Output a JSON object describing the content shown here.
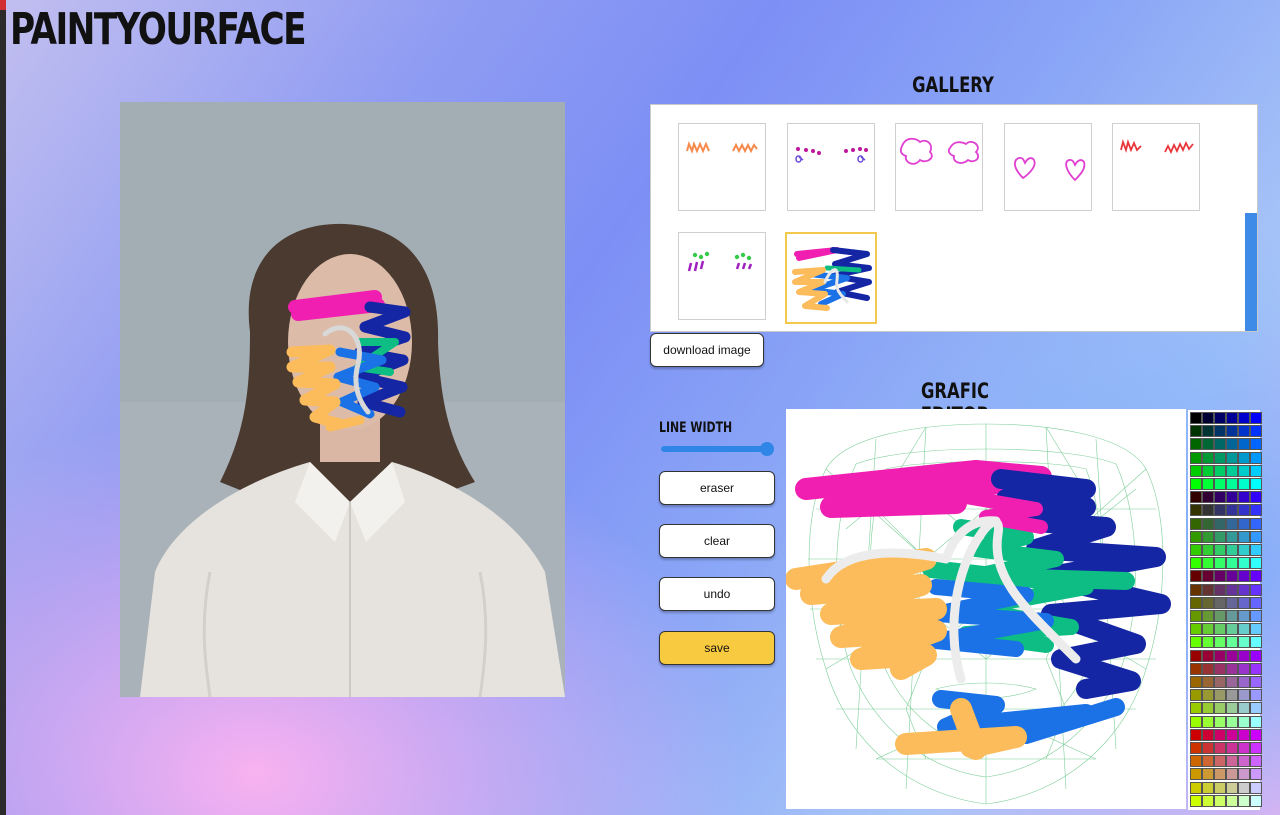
{
  "app": {
    "title": "PAINTYOURFACE"
  },
  "gallery": {
    "title": "GALLERY",
    "thumbnails": [
      {
        "name": "orange-lashes",
        "selected": false
      },
      {
        "name": "purple-dots",
        "selected": false
      },
      {
        "name": "pink-clouds",
        "selected": false
      },
      {
        "name": "pink-hearts",
        "selected": false
      },
      {
        "name": "red-lashes",
        "selected": false
      },
      {
        "name": "green-purple-marks",
        "selected": false
      },
      {
        "name": "colorful-scribble",
        "selected": true
      }
    ],
    "download_label": "download image"
  },
  "editor": {
    "title": "GRAFIC EDITOR",
    "line_width_label": "LINE WIDTH",
    "line_width_value": 1.0,
    "buttons": {
      "eraser": "eraser",
      "clear": "clear",
      "undo": "undo",
      "save": "save"
    }
  },
  "colors": {
    "pink": "#f01fb1",
    "navy": "#1426a4",
    "green": "#0dbd83",
    "blue": "#1a72e6",
    "orange": "#fcbc5c",
    "accent": "#2f86e6",
    "save": "#f8ca3f"
  },
  "palette": {
    "rows": [
      [
        "#000000",
        "#000033",
        "#000066",
        "#000099",
        "#0000cc",
        "#0000ff"
      ],
      [
        "#003300",
        "#003333",
        "#003366",
        "#003399",
        "#0033cc",
        "#0033ff"
      ],
      [
        "#006600",
        "#006633",
        "#006666",
        "#006699",
        "#0066cc",
        "#0066ff"
      ],
      [
        "#009900",
        "#009933",
        "#009966",
        "#009999",
        "#0099cc",
        "#0099ff"
      ],
      [
        "#00cc00",
        "#00cc33",
        "#00cc66",
        "#00cc99",
        "#00cccc",
        "#00ccff"
      ],
      [
        "#00ff00",
        "#00ff33",
        "#00ff66",
        "#00ff99",
        "#00ffcc",
        "#00ffff"
      ],
      [
        "#330000",
        "#330033",
        "#330066",
        "#330099",
        "#3300cc",
        "#3300ff"
      ],
      [
        "#333300",
        "#333333",
        "#333366",
        "#333399",
        "#3333cc",
        "#3333ff"
      ],
      [
        "#336600",
        "#336633",
        "#336666",
        "#336699",
        "#3366cc",
        "#3366ff"
      ],
      [
        "#339900",
        "#339933",
        "#339966",
        "#339999",
        "#3399cc",
        "#3399ff"
      ],
      [
        "#33cc00",
        "#33cc33",
        "#33cc66",
        "#33cc99",
        "#33cccc",
        "#33ccff"
      ],
      [
        "#33ff00",
        "#33ff33",
        "#33ff66",
        "#33ff99",
        "#33ffcc",
        "#33ffff"
      ],
      [
        "#660000",
        "#660033",
        "#660066",
        "#660099",
        "#6600cc",
        "#6600ff"
      ],
      [
        "#663300",
        "#663333",
        "#663366",
        "#663399",
        "#6633cc",
        "#6633ff"
      ],
      [
        "#666600",
        "#666633",
        "#666666",
        "#666699",
        "#6666cc",
        "#6666ff"
      ],
      [
        "#669900",
        "#669933",
        "#669966",
        "#669999",
        "#6699cc",
        "#6699ff"
      ],
      [
        "#66cc00",
        "#66cc33",
        "#66cc66",
        "#66cc99",
        "#66cccc",
        "#66ccff"
      ],
      [
        "#66ff00",
        "#66ff33",
        "#66ff66",
        "#66ff99",
        "#66ffcc",
        "#66ffff"
      ],
      [
        "#990000",
        "#990033",
        "#990066",
        "#990099",
        "#9900cc",
        "#9900ff"
      ],
      [
        "#993300",
        "#993333",
        "#993366",
        "#993399",
        "#9933cc",
        "#9933ff"
      ],
      [
        "#996600",
        "#996633",
        "#996666",
        "#996699",
        "#9966cc",
        "#9966ff"
      ],
      [
        "#999900",
        "#999933",
        "#999966",
        "#999999",
        "#9999cc",
        "#9999ff"
      ],
      [
        "#99cc00",
        "#99cc33",
        "#99cc66",
        "#99cc99",
        "#99cccc",
        "#99ccff"
      ],
      [
        "#99ff00",
        "#99ff33",
        "#99ff66",
        "#99ff99",
        "#99ffcc",
        "#99ffff"
      ],
      [
        "#cc0000",
        "#cc0033",
        "#cc0066",
        "#cc0099",
        "#cc00cc",
        "#cc00ff"
      ],
      [
        "#cc3300",
        "#cc3333",
        "#cc3366",
        "#cc3399",
        "#cc33cc",
        "#cc33ff"
      ],
      [
        "#cc6600",
        "#cc6633",
        "#cc6666",
        "#cc6699",
        "#cc66cc",
        "#cc66ff"
      ],
      [
        "#cc9900",
        "#cc9933",
        "#cc9966",
        "#cc9999",
        "#cc99cc",
        "#cc99ff"
      ],
      [
        "#cccc00",
        "#cccc33",
        "#cccc66",
        "#cccc99",
        "#cccccc",
        "#ccccff"
      ],
      [
        "#ccff00",
        "#ccff33",
        "#ccff66",
        "#ccff99",
        "#ccffcc",
        "#ccffff"
      ]
    ]
  }
}
